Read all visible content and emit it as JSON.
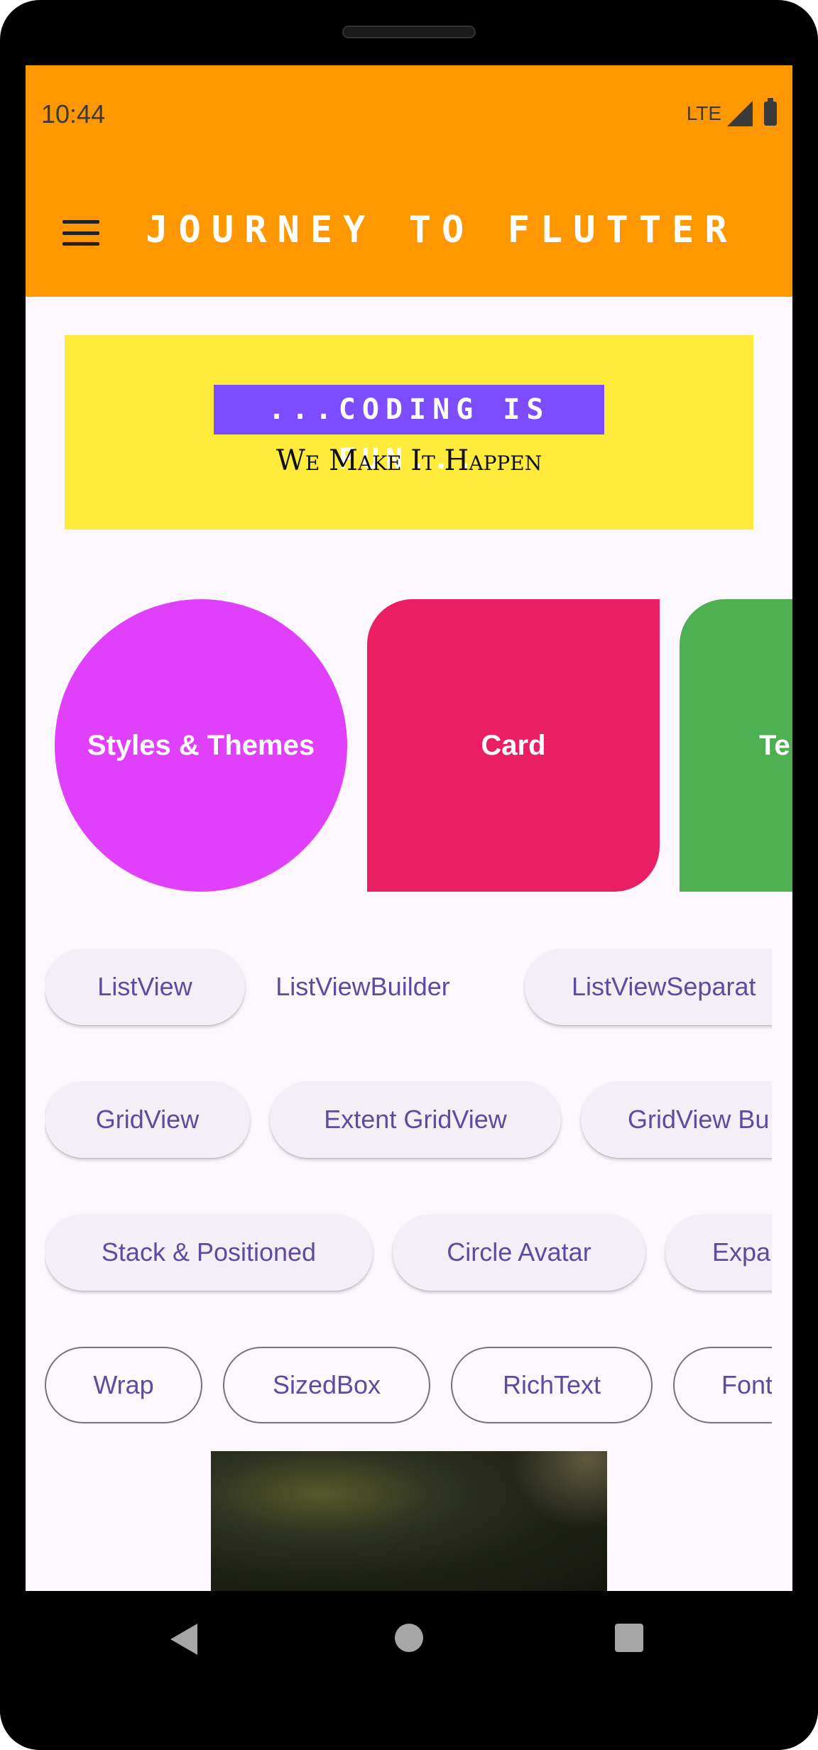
{
  "status_bar": {
    "time": "10:44",
    "network": "LTE"
  },
  "app_bar": {
    "title": "Journey to Flutter",
    "menu_icon": "menu-icon",
    "background_color": "#ff9800"
  },
  "banner": {
    "tag": "...Coding is fun...",
    "subtitle": "We Make It Happen",
    "background_color": "#ffeb3b",
    "tag_color": "#7c4dff"
  },
  "shape_cards": [
    {
      "label": "Styles & Themes",
      "color": "#e040fb"
    },
    {
      "label": "Card",
      "color": "#e91e63"
    },
    {
      "label": "Te",
      "color": "#4caf50"
    }
  ],
  "chip_rows": [
    {
      "style": "mixed",
      "items": [
        {
          "label": "ListView"
        },
        {
          "label": "ListViewBuilder"
        },
        {
          "label": "ListViewSeparat"
        }
      ]
    },
    {
      "style": "elevated",
      "items": [
        {
          "label": "GridView"
        },
        {
          "label": "Extent GridView"
        },
        {
          "label": "GridView Bu"
        }
      ]
    },
    {
      "style": "elevated",
      "items": [
        {
          "label": "Stack & Positioned"
        },
        {
          "label": "Circle Avatar"
        },
        {
          "label": "Expa"
        }
      ]
    },
    {
      "style": "outlined",
      "items": [
        {
          "label": "Wrap"
        },
        {
          "label": "SizedBox"
        },
        {
          "label": "RichText"
        },
        {
          "label": "Font"
        }
      ]
    }
  ],
  "image": {
    "icon": "photo-image"
  },
  "nav_bar": {
    "back_icon": "back-icon",
    "home_icon": "home-icon",
    "recents_icon": "recents-icon"
  }
}
